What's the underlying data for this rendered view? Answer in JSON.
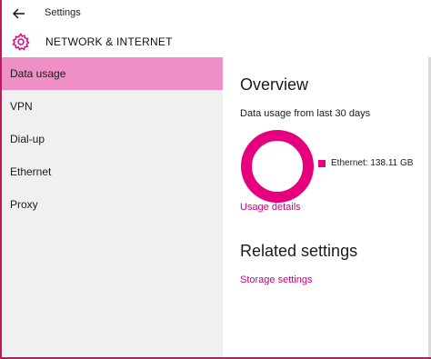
{
  "window": {
    "title": "Settings"
  },
  "header": {
    "title": "NETWORK & INTERNET",
    "icon": "gear-icon"
  },
  "sidebar": {
    "items": [
      {
        "label": "Data usage",
        "selected": true
      },
      {
        "label": "VPN",
        "selected": false
      },
      {
        "label": "Dial-up",
        "selected": false
      },
      {
        "label": "Ethernet",
        "selected": false
      },
      {
        "label": "Proxy",
        "selected": false
      }
    ]
  },
  "main": {
    "overview_heading": "Overview",
    "usage_period": "Data usage from last 30 days",
    "legend_label": "Ethernet: 138.11 GB",
    "usage_details_link": "Usage details",
    "related_heading": "Related settings",
    "storage_link": "Storage settings"
  },
  "colors": {
    "accent": "#e6007e",
    "selected_bg": "#ee8fc6",
    "sidebar_bg": "#f0f0f0",
    "link": "#d1007b",
    "window_border": "#c2185b"
  },
  "chart_data": {
    "type": "pie",
    "categories": [
      "Ethernet"
    ],
    "values": [
      138.11
    ],
    "unit": "GB"
  }
}
